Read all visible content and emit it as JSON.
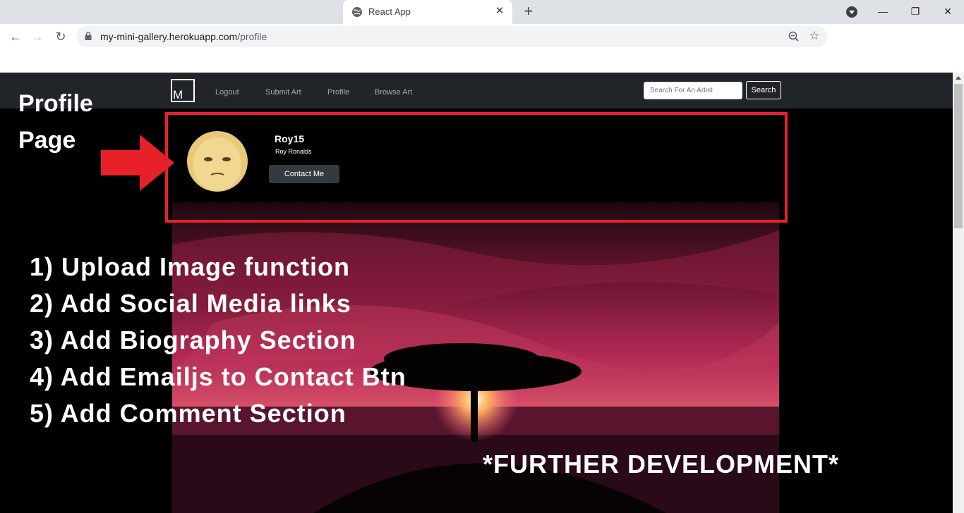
{
  "browser": {
    "tab_title": "React App",
    "tab_close": "✕",
    "new_tab": "+",
    "url_host": "my-mini-gallery.herokuapp.com",
    "url_path": "/profile",
    "back": "←",
    "forward": "→",
    "reload": "↻",
    "star": "☆",
    "minimize": "—",
    "maximize": "❐",
    "close": "✕"
  },
  "site_nav": {
    "brand": "M",
    "links": [
      "Logout",
      "Submit Art",
      "Profile",
      "Browse Art"
    ],
    "search_placeholder": "Search For An Artist",
    "search_button": "Search"
  },
  "profile": {
    "username": "Roy15",
    "full_name": "Roy Ronalds",
    "contact_button": "Contact Me"
  },
  "annotations": {
    "title_line1": "Profile",
    "title_line2": "Page",
    "items": [
      "1) Upload Image function",
      "2) Add Social Media links",
      "3) Add Biography Section",
      "4) Add Emailjs to Contact Btn",
      "5) Add Comment Section"
    ],
    "footer": "*FURTHER DEVELOPMENT*",
    "highlight_color": "#e8202a"
  }
}
